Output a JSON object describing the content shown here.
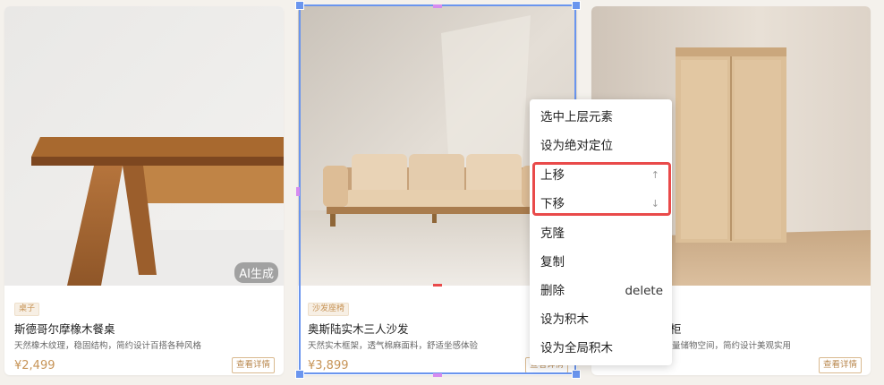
{
  "cards": [
    {
      "tag": "桌子",
      "title": "斯德哥尔摩橡木餐桌",
      "desc": "天然橡木纹理，稳固结构，简约设计百搭各种风格",
      "price": "¥2,499",
      "detail": "查看详情",
      "badge": "AI生成"
    },
    {
      "tag": "沙发座椅",
      "title": "奥斯陆实木三人沙发",
      "desc": "天然实木框架，透气棉麻面料，舒适坐感体验",
      "price": "¥3,899",
      "detail": "查看详情"
    },
    {
      "title": "柜",
      "desc": "量储物空间，简约设计美观实用",
      "detail": "查看详情"
    }
  ],
  "menu": {
    "items": [
      "选中上层元素",
      "设为绝对定位",
      "上移",
      "下移",
      "克隆",
      "复制",
      "删除",
      "设为积木",
      "设为全局积木"
    ],
    "delete_shortcut": "delete",
    "up_arrow": "↑",
    "down_arrow": "↓"
  }
}
